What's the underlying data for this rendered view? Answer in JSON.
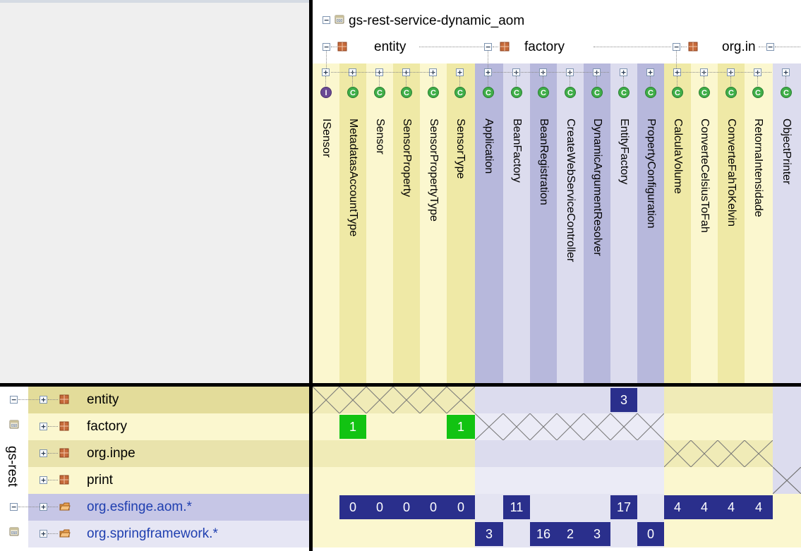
{
  "project": {
    "name": "gs-rest-service-dynamic_aom",
    "side_label": "gs-rest"
  },
  "column_packages": [
    {
      "name": "entity",
      "columns": [
        0,
        1,
        2,
        3,
        4,
        5
      ]
    },
    {
      "name": "factory",
      "columns": [
        6,
        7,
        8,
        9,
        10,
        11,
        12
      ]
    },
    {
      "name": "org.in",
      "columns": [
        13,
        14,
        15,
        16
      ]
    }
  ],
  "columns": [
    {
      "name": "ISensor",
      "kind": "interface"
    },
    {
      "name": "MetadatasAccountType",
      "kind": "class"
    },
    {
      "name": "Sensor",
      "kind": "class"
    },
    {
      "name": "SensorProperty",
      "kind": "class"
    },
    {
      "name": "SensorPropertyType",
      "kind": "class"
    },
    {
      "name": "SensorType",
      "kind": "class"
    },
    {
      "name": "Application",
      "kind": "class"
    },
    {
      "name": "BeanFactory",
      "kind": "class"
    },
    {
      "name": "BeanRegistration",
      "kind": "class"
    },
    {
      "name": "CreateWebServiceController",
      "kind": "class"
    },
    {
      "name": "DynamicArgumentResolver",
      "kind": "class"
    },
    {
      "name": "EntityFactory",
      "kind": "class"
    },
    {
      "name": "PropertyConfiguration",
      "kind": "class"
    },
    {
      "name": "CalculaVolume",
      "kind": "class"
    },
    {
      "name": "ConverteCelsiusToFah",
      "kind": "class"
    },
    {
      "name": "ConverteFahToKelvin",
      "kind": "class"
    },
    {
      "name": "RetornaIntensidade",
      "kind": "class"
    },
    {
      "name": "ObjectPrinter",
      "kind": "class"
    }
  ],
  "rows": [
    {
      "name": "entity",
      "kind": "package",
      "external": false,
      "group": 0
    },
    {
      "name": "factory",
      "kind": "package",
      "external": false,
      "group": 1
    },
    {
      "name": "org.inpe",
      "kind": "package",
      "external": false,
      "group": 2
    },
    {
      "name": "print",
      "kind": "package",
      "external": false,
      "group": 3
    },
    {
      "name": "org.esfinge.aom.*",
      "kind": "external",
      "external": true,
      "group": -1
    },
    {
      "name": "org.springframework.*",
      "kind": "external",
      "external": true,
      "group": -1
    }
  ],
  "cells": [
    {
      "row": 0,
      "col": 11,
      "value": "3",
      "style": "dark"
    },
    {
      "row": 1,
      "col": 1,
      "value": "1",
      "style": "green"
    },
    {
      "row": 1,
      "col": 5,
      "value": "1",
      "style": "green"
    },
    {
      "row": 4,
      "col": 1,
      "value": "0",
      "style": "dark"
    },
    {
      "row": 4,
      "col": 2,
      "value": "0",
      "style": "dark"
    },
    {
      "row": 4,
      "col": 3,
      "value": "0",
      "style": "dark"
    },
    {
      "row": 4,
      "col": 4,
      "value": "0",
      "style": "dark"
    },
    {
      "row": 4,
      "col": 5,
      "value": "0",
      "style": "dark"
    },
    {
      "row": 4,
      "col": 7,
      "value": "11",
      "style": "dark"
    },
    {
      "row": 4,
      "col": 11,
      "value": "17",
      "style": "dark"
    },
    {
      "row": 4,
      "col": 13,
      "value": "4",
      "style": "dark"
    },
    {
      "row": 4,
      "col": 14,
      "value": "4",
      "style": "dark"
    },
    {
      "row": 4,
      "col": 15,
      "value": "4",
      "style": "dark"
    },
    {
      "row": 4,
      "col": 16,
      "value": "4",
      "style": "dark"
    },
    {
      "row": 5,
      "col": 6,
      "value": "3",
      "style": "dark"
    },
    {
      "row": 5,
      "col": 8,
      "value": "16",
      "style": "dark"
    },
    {
      "row": 5,
      "col": 9,
      "value": "2",
      "style": "dark"
    },
    {
      "row": 5,
      "col": 10,
      "value": "3",
      "style": "dark"
    },
    {
      "row": 5,
      "col": 12,
      "value": "0",
      "style": "dark"
    }
  ],
  "colors": {
    "yellow_dark": "#efe9a6",
    "yellow_light": "#fbf7cf",
    "purple_dark": "#b7b8dc",
    "purple_light": "#dcdcee",
    "cell_dark": "#2a2f8c",
    "cell_green": "#12c312",
    "row_entity": "#e3dc9a",
    "row_factory": "#fbf7cf",
    "row_orginpe": "#e9e3ac",
    "row_print": "#fbf7cf",
    "row_ext1": "#c6c6e6",
    "row_ext2": "#e6e6f4",
    "link_blue": "#1f3fb0"
  }
}
